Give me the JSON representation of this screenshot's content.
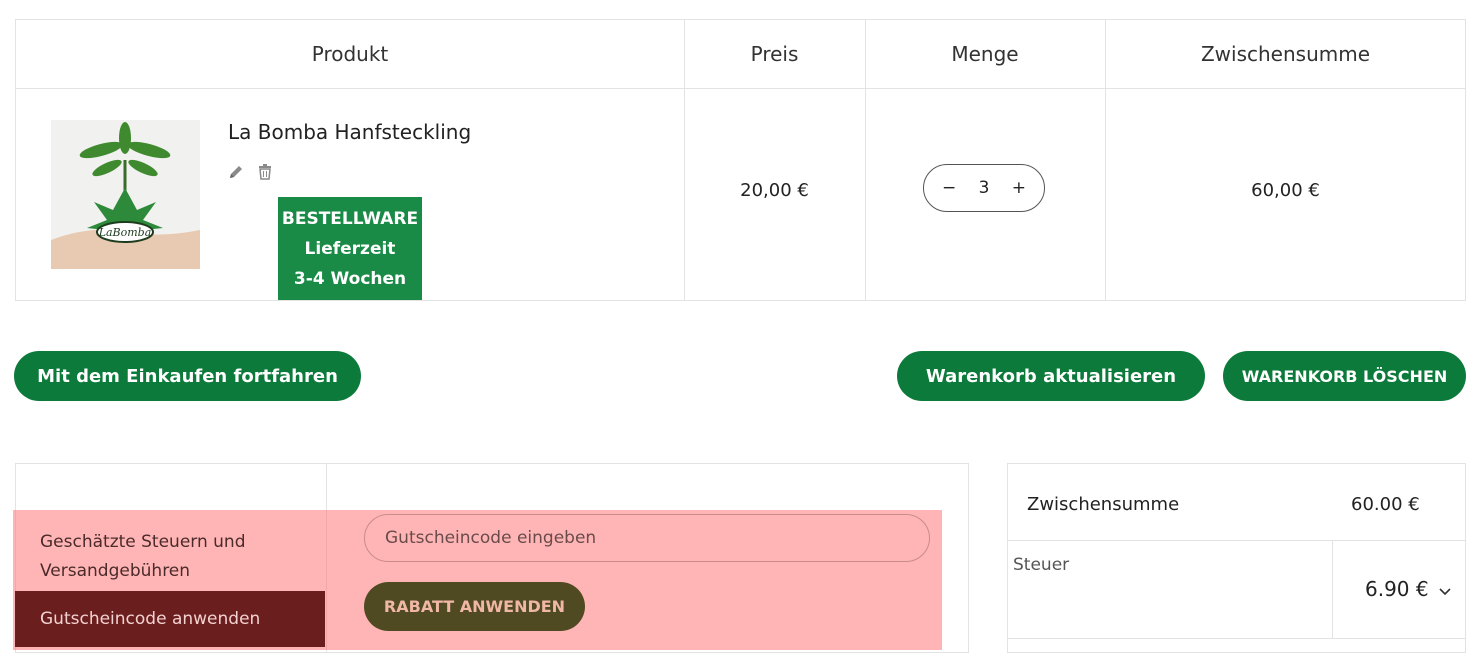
{
  "table": {
    "headers": [
      "Produkt",
      "Preis",
      "Menge",
      "Zwischensumme"
    ]
  },
  "item": {
    "name": "La Bomba Hanfsteckling",
    "image_label": "LaBomba",
    "badge": [
      "BESTELLWARE",
      "Lieferzeit",
      "3-4 Wochen"
    ],
    "price": "20,00 €",
    "qty": {
      "minus": "−",
      "value": "3",
      "plus": "+"
    },
    "subtotal": "60,00 €"
  },
  "actions": {
    "continue": "Mit dem Einkaufen fortfahren",
    "update": "Warenkorb aktualisieren",
    "clear": "WARENKORB LÖSCHEN"
  },
  "coupon": {
    "tab_estimate": "Geschätzte Steuern und Versandgebühren",
    "tab_coupon": "Gutscheincode anwenden",
    "placeholder": "Gutscheincode eingeben",
    "apply": "RABATT ANWENDEN"
  },
  "totals": {
    "subtotal_label": "Zwischensumme",
    "subtotal_value": "60.00 €",
    "tax_label": "Steuer",
    "tax_value": "6.90 €"
  },
  "colors": {
    "green": "#0c7a3a",
    "badge_green": "#1a8a47",
    "coupon_tab": "#6b1e1e",
    "apply_button": "#4f4a22"
  }
}
